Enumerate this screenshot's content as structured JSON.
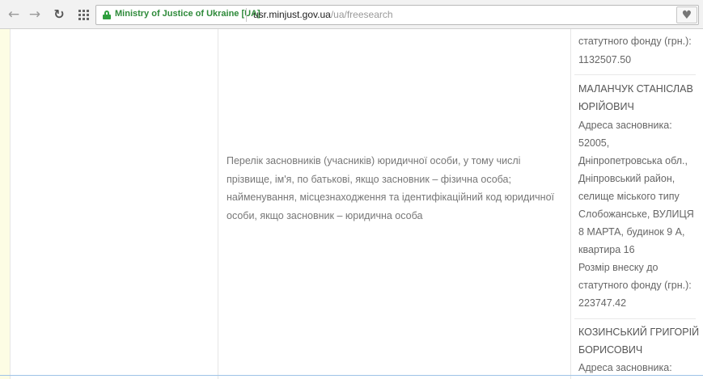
{
  "browser": {
    "ev_name": "Ministry of Justice of Ukraine [UA]",
    "url_host": "usr.minjust.gov.ua",
    "url_path": "/ua/freesearch",
    "icons": {
      "back": "back-arrow-icon",
      "forward": "forward-arrow-icon",
      "reload": "reload-icon",
      "apps": "apps-grid-icon",
      "lock": "lock-icon",
      "bookmark": "heart-bookmark-icon"
    }
  },
  "main": {
    "field_label": "Перелік засновників (учасників) юридичної особи, у тому числі прізвище, ім'я, по батькові, якщо засновник – фізична особа; найменування, місцезнаходження та ідентифікаційний код юридичної особи, якщо засновник – юридична особа",
    "founders_top": {
      "line1_partial": "статутного фонду (грн.):",
      "amount": "1132507.50"
    },
    "founder1": {
      "name_line1": "МАЛАНЧУК СТАНІСЛАВ",
      "name_line2": "ЮРІЙОВИЧ",
      "address_label": "Адреса засновника:",
      "address_lines": [
        "52005,",
        "Дніпропетровська обл.,",
        "Дніпровський район,",
        "селище міського типу",
        "Слобожанське, ВУЛИЦЯ",
        "8 МАРТА, будинок 9 А,",
        "квартира 16"
      ],
      "contribution_label_1": "Розмір внеску до",
      "contribution_label_2": "статутного фонду (грн.):",
      "amount": "223747.42"
    },
    "founder2": {
      "name_line1": "КОЗИНСЬКИЙ ГРИГОРІЙ",
      "name_line2": "БОРИСОВИЧ",
      "address_label": "Адреса засновника:"
    }
  }
}
